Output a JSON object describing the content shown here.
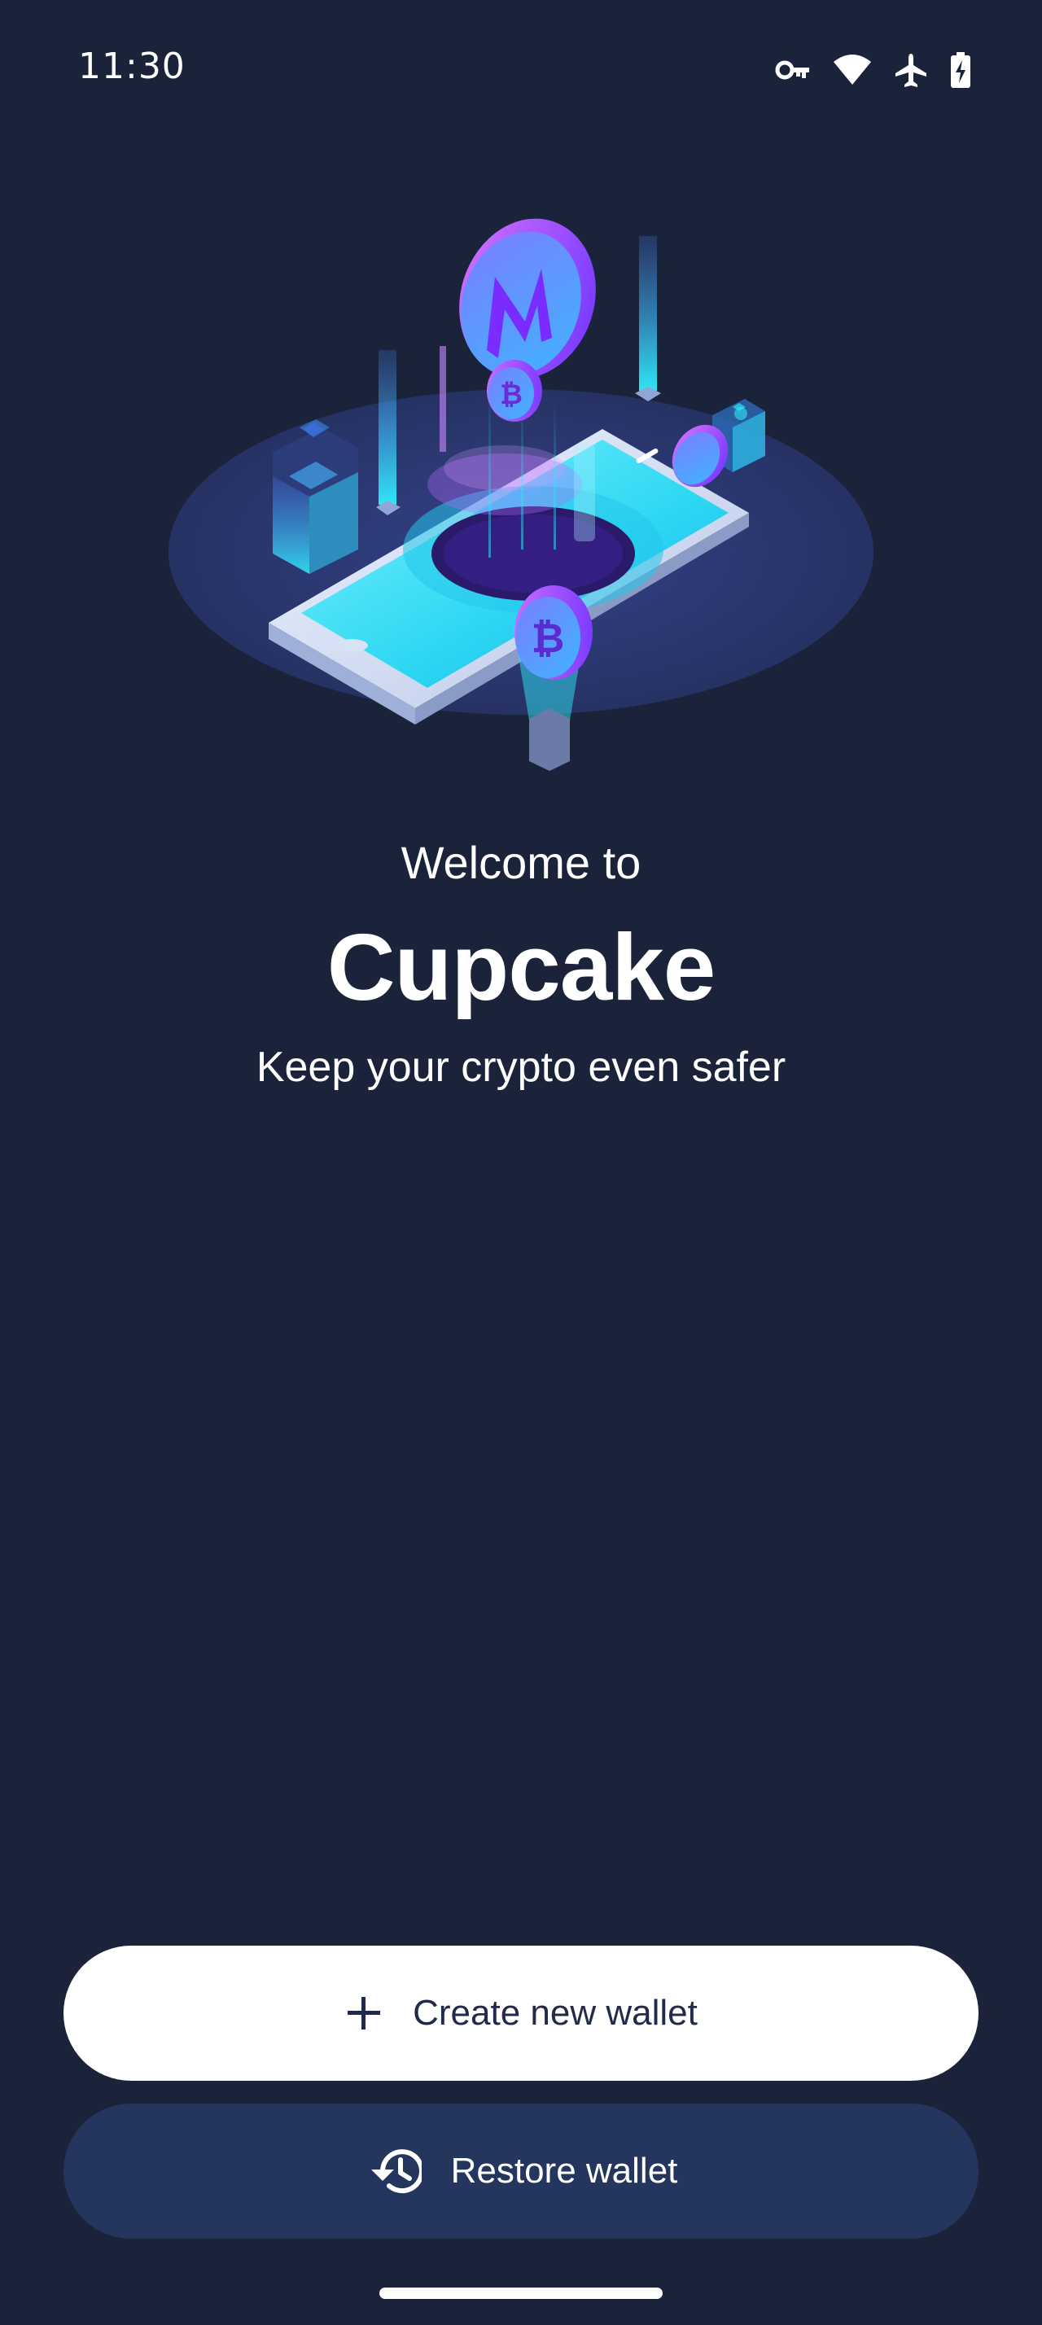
{
  "status_bar": {
    "time": "11:30",
    "icons": [
      "vpn-key-icon",
      "wifi-icon",
      "airplane-mode-icon",
      "battery-charging-icon"
    ]
  },
  "hero": {
    "illustration": "crypto-phone-illustration",
    "coin_symbols": [
      "M",
      "₿",
      "₿"
    ]
  },
  "welcome": {
    "line": "Welcome to",
    "app_name": "Cupcake",
    "tagline": "Keep your crypto even safer"
  },
  "actions": {
    "create_label": "Create new wallet",
    "create_icon": "plus-icon",
    "restore_label": "Restore wallet",
    "restore_icon": "history-icon"
  },
  "colors": {
    "background": "#1b233b",
    "primary_button": "#ffffff",
    "primary_button_text": "#222a4a",
    "secondary_button": "#24355e",
    "accent_cyan": "#2fe6f5",
    "accent_purple": "#9b4dff"
  }
}
